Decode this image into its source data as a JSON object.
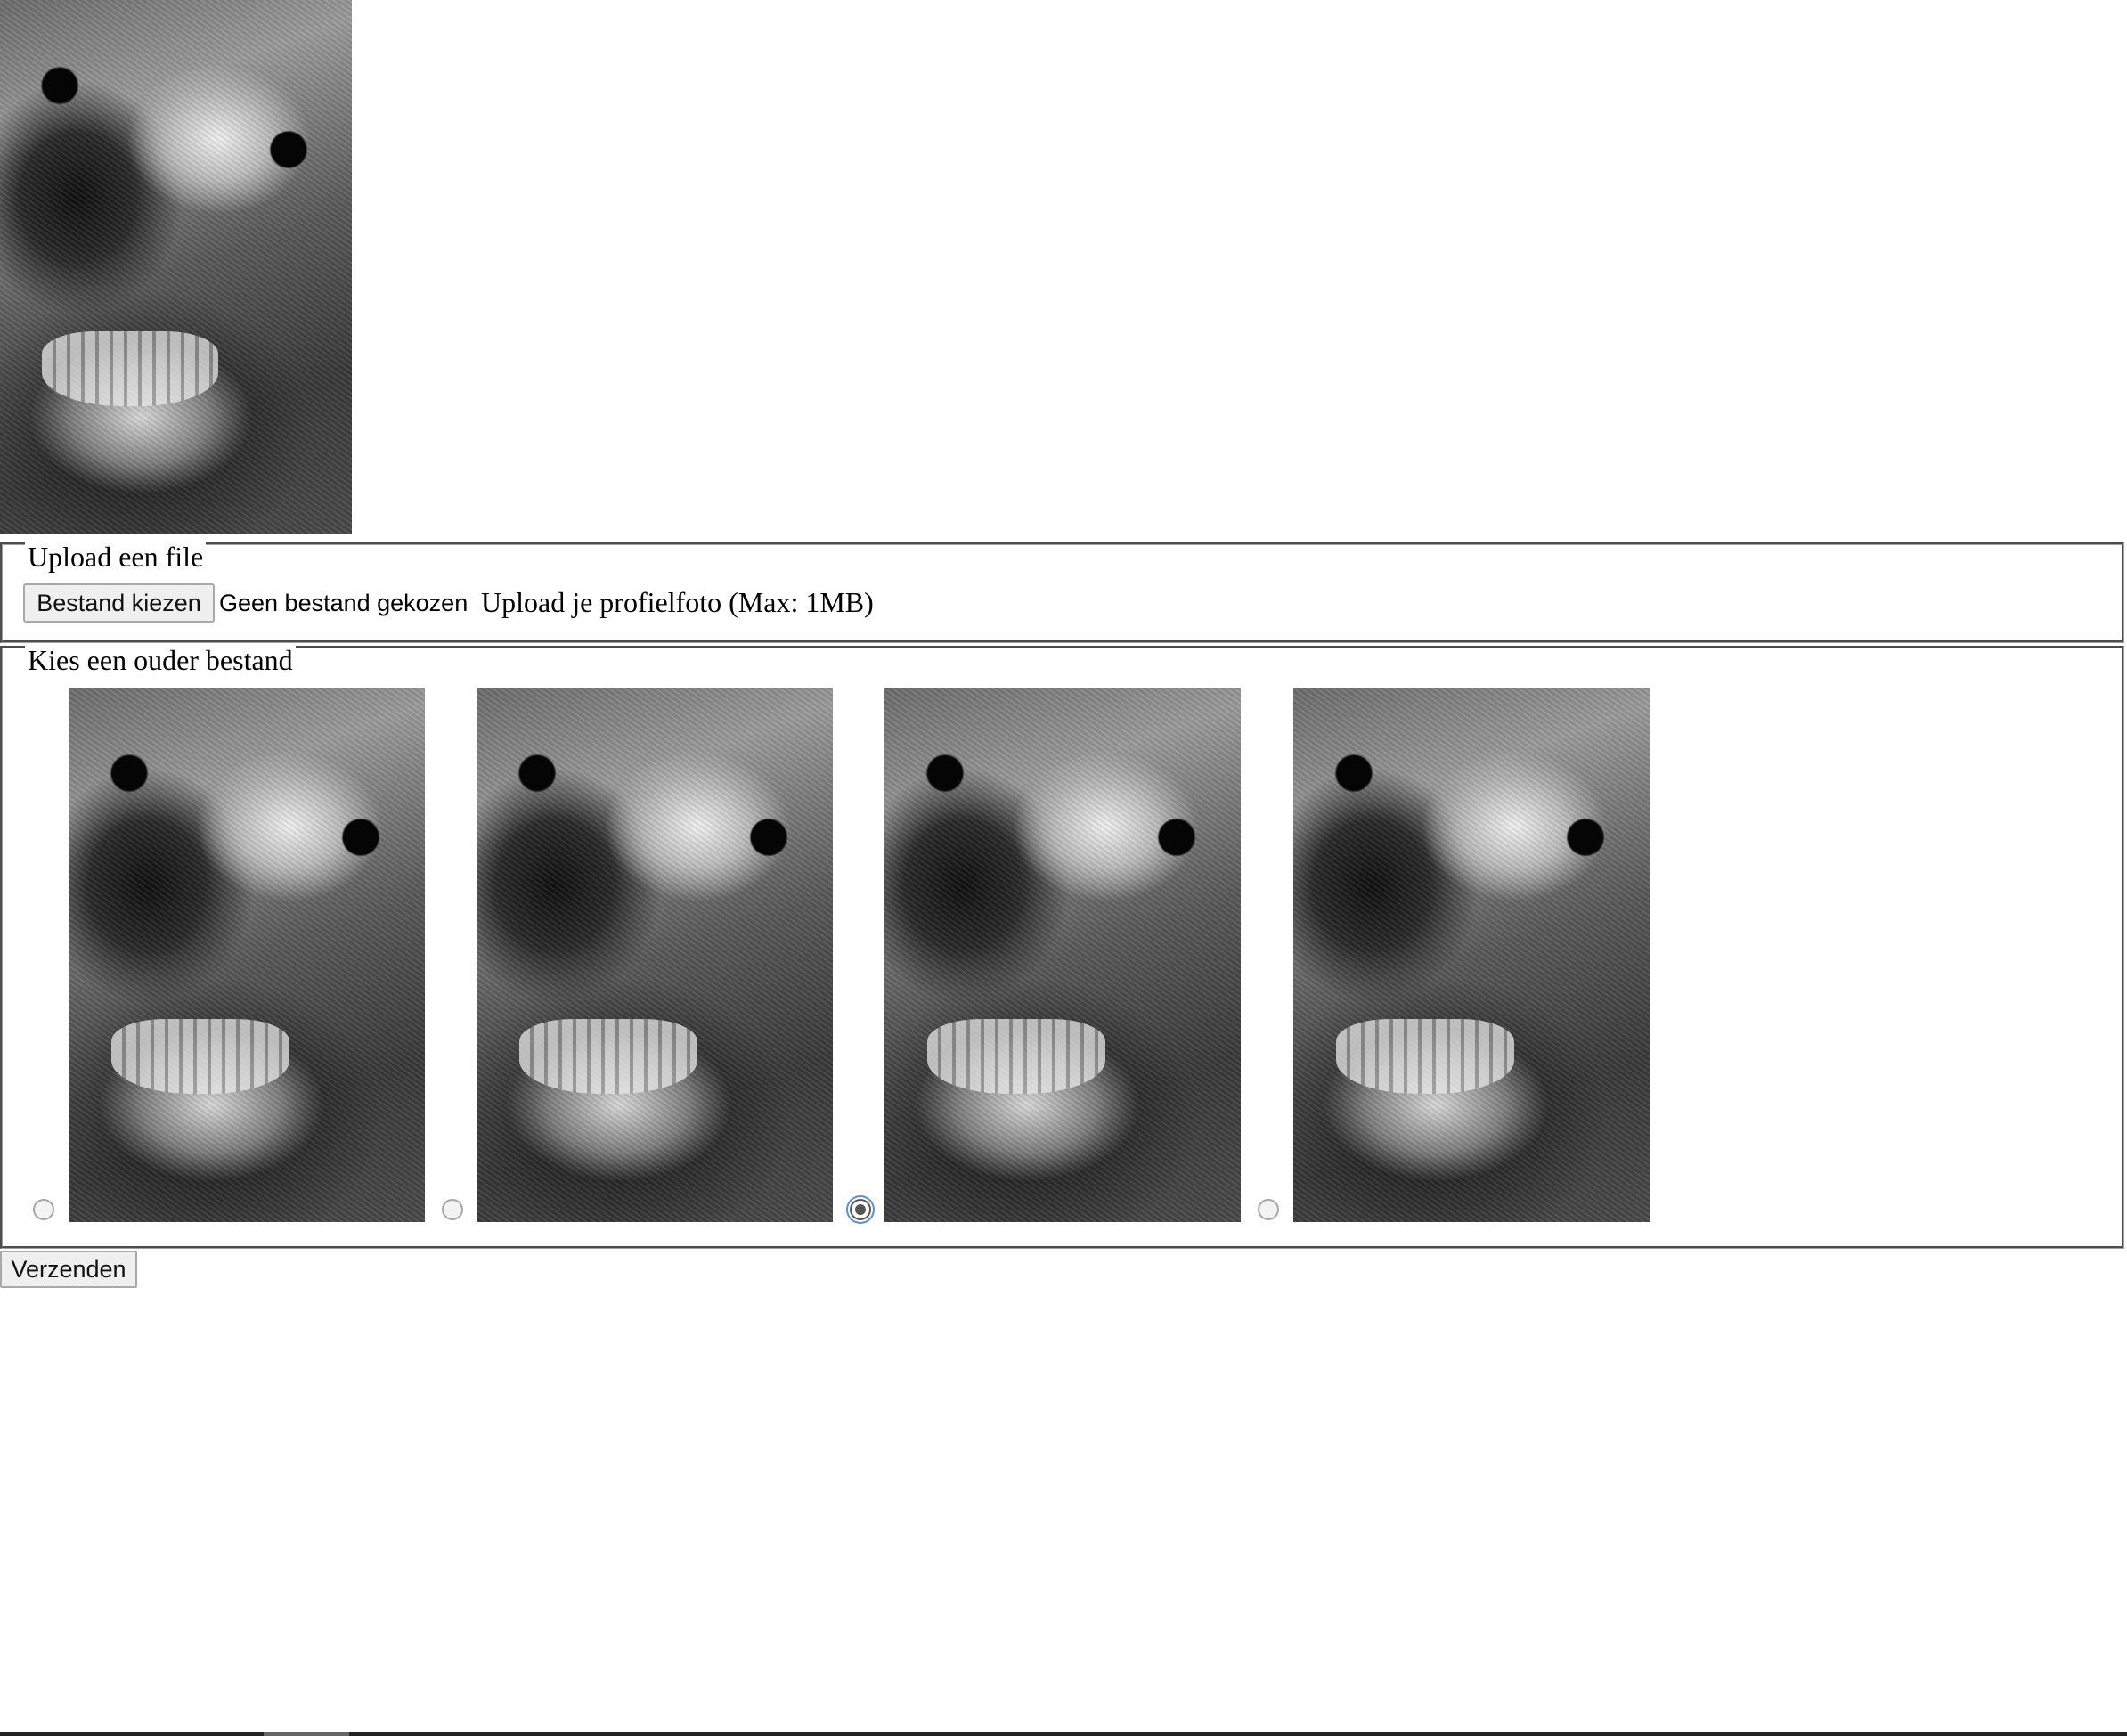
{
  "upload": {
    "legend": "Upload een file",
    "choose_button": "Bestand kiezen",
    "file_status": "Geen bestand gekozen",
    "hint": "Upload je profielfoto (Max: 1MB)"
  },
  "older": {
    "legend": "Kies een ouder bestand",
    "options": [
      {
        "selected": false
      },
      {
        "selected": false
      },
      {
        "selected": true
      },
      {
        "selected": false
      }
    ]
  },
  "submit_label": "Verzenden"
}
